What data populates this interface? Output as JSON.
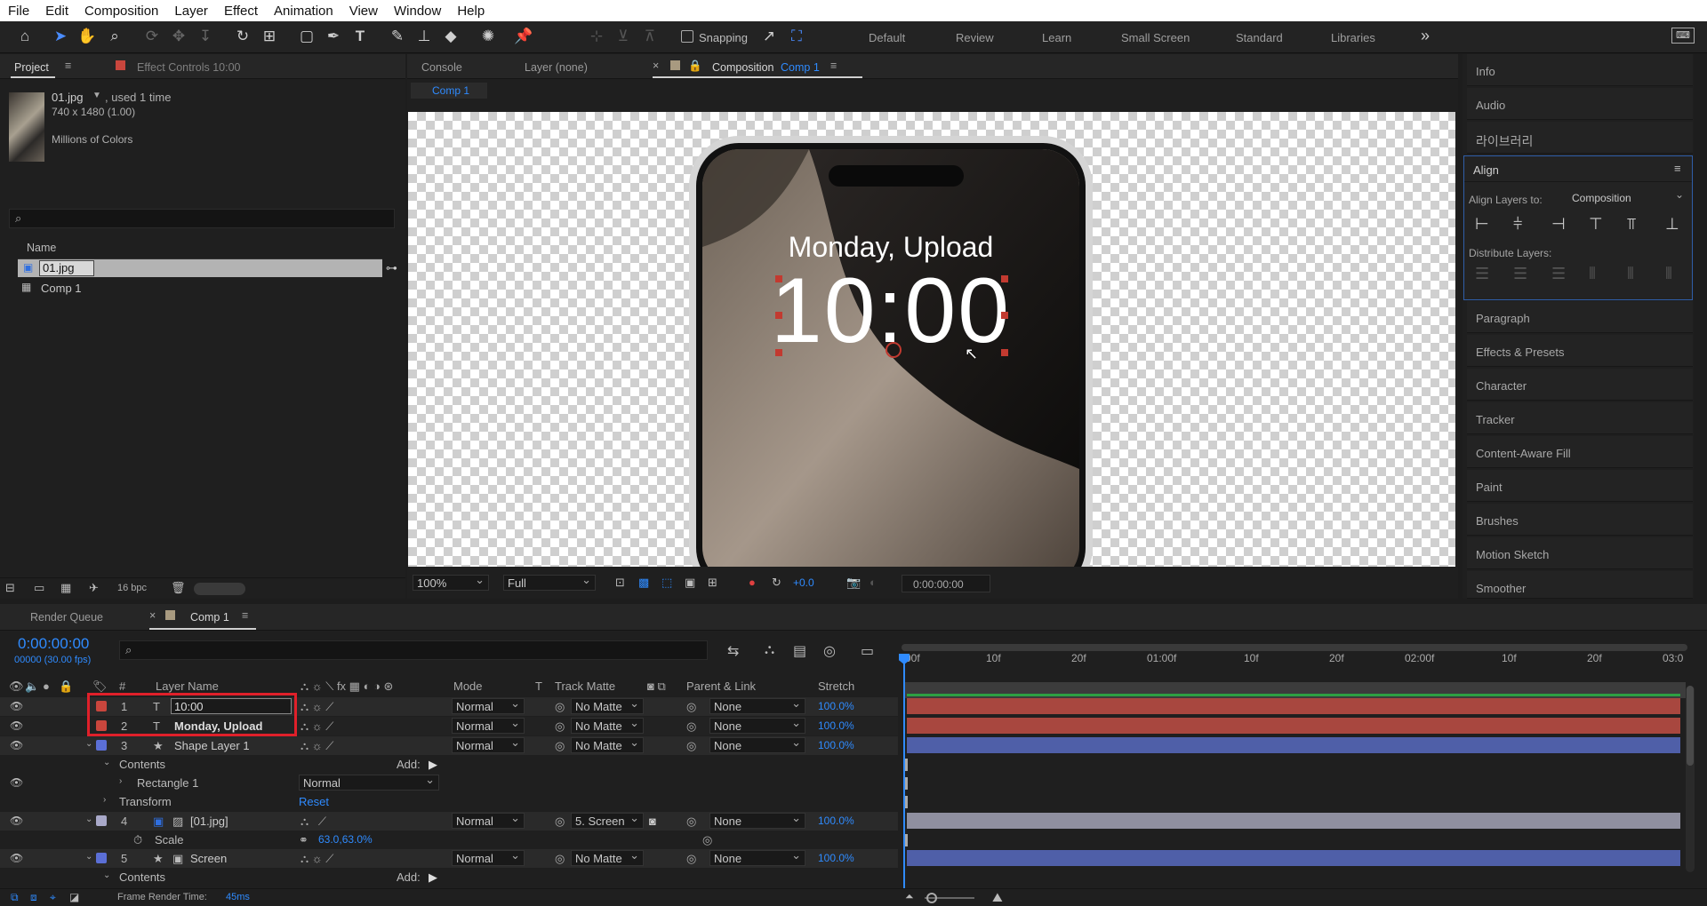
{
  "menu": [
    "File",
    "Edit",
    "Composition",
    "Layer",
    "Effect",
    "Animation",
    "View",
    "Window",
    "Help"
  ],
  "toolbar": {
    "snapping_label": "Snapping",
    "workspaces": [
      "Default",
      "Review",
      "Learn",
      "Small Screen",
      "Standard",
      "Libraries"
    ],
    "more": "»"
  },
  "project": {
    "tab_label": "Project",
    "effect_controls_label": "Effect Controls 10:00",
    "file_name": "01.jpg",
    "file_usage": ", used 1 time",
    "dimensions": "740 x 1480 (1.00)",
    "color_depth": "Millions of Colors",
    "name_header": "Name",
    "items": [
      {
        "name": "01.jpg"
      },
      {
        "name": "Comp 1"
      }
    ],
    "bpc": "16 bpc"
  },
  "viewer": {
    "tabs": [
      "Console",
      "Layer (none)"
    ],
    "comp_tab_prefix": "Composition",
    "comp_tab_name": "Comp 1",
    "breadcrumb": "Comp 1",
    "phone_date": "Monday, Upload",
    "phone_time": "10:00",
    "zoom": "100%",
    "resolution": "Full",
    "exposure": "+0.0",
    "timecode": "0:00:00:00"
  },
  "right_panel": {
    "items_top": [
      "Info",
      "Audio",
      "라이브러리"
    ],
    "align": {
      "title": "Align",
      "align_to_label": "Align Layers to:",
      "align_to_value": "Composition",
      "distribute_label": "Distribute Layers:"
    },
    "items_bottom": [
      "Paragraph",
      "Effects & Presets",
      "Character",
      "Tracker",
      "Content-Aware Fill",
      "Paint",
      "Brushes",
      "Motion Sketch",
      "Smoother"
    ]
  },
  "timeline": {
    "tabs": [
      "Render Queue",
      "Comp 1"
    ],
    "current_time": "0:00:00:00",
    "fps": "00000 (30.00 fps)",
    "headers": {
      "num": "#",
      "layer_name": "Layer Name",
      "mode": "Mode",
      "t": "T",
      "track_matte": "Track Matte",
      "parent": "Parent & Link",
      "stretch": "Stretch"
    },
    "ruler": [
      "00f",
      "10f",
      "20f",
      "01:00f",
      "10f",
      "20f",
      "02:00f",
      "10f",
      "20f",
      "03:0"
    ],
    "layers": [
      {
        "num": "1",
        "type": "T",
        "name": "10:00",
        "mode": "Normal",
        "matte": "No Matte",
        "parent": "None",
        "stretch": "100.0%",
        "color": "#c9463d"
      },
      {
        "num": "2",
        "type": "T",
        "name": "Monday, Upload",
        "mode": "Normal",
        "matte": "No Matte",
        "parent": "None",
        "stretch": "100.0%",
        "color": "#c9463d"
      },
      {
        "num": "3",
        "type": "★",
        "name": "Shape Layer 1",
        "mode": "Normal",
        "matte": "No Matte",
        "parent": "None",
        "stretch": "100.0%",
        "color": "#5b6fd6"
      }
    ],
    "sub_rows": {
      "contents": "Contents",
      "add": "Add:",
      "rectangle": "Rectangle 1",
      "rectangle_mode": "Normal",
      "transform": "Transform",
      "reset": "Reset"
    },
    "layer4": {
      "num": "4",
      "name": "[01.jpg]",
      "mode": "Normal",
      "matte": "5. Screen",
      "parent": "None",
      "stretch": "100.0%",
      "color": "#a9a9c9"
    },
    "scale_label": "Scale",
    "scale_value": "63.0,63.0%",
    "layer5": {
      "num": "5",
      "type": "★",
      "name": "Screen",
      "mode": "Normal",
      "matte": "No Matte",
      "parent": "None",
      "stretch": "100.0%",
      "color": "#5b6fd6"
    },
    "contents2": "Contents",
    "add2": "Add:",
    "footer_label": "Frame Render Time:",
    "footer_value": "45ms"
  },
  "colors": {
    "accent": "#2f8bff",
    "red_highlight": "#e0202a",
    "red_bar": "#b04a45",
    "blue_bar": "#4f5fa8",
    "grey_bar": "#8f8f9f"
  }
}
